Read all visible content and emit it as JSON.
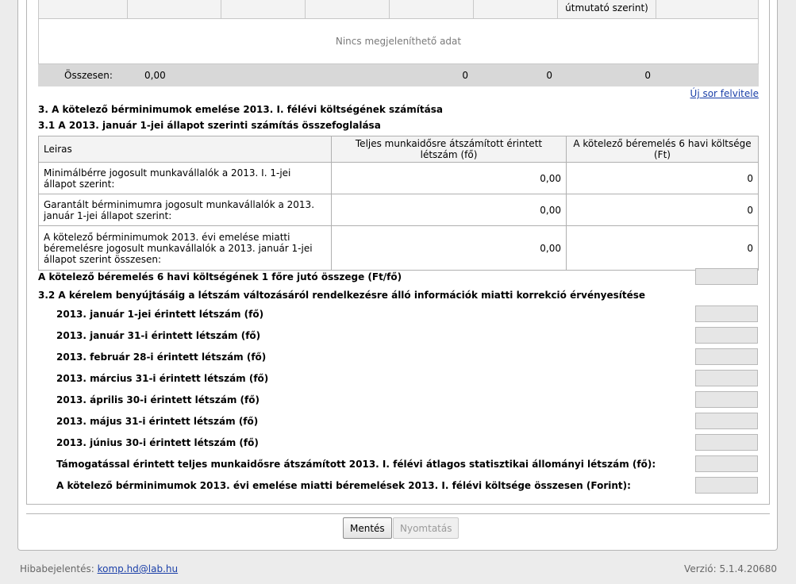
{
  "top_table": {
    "header_partial": "útmutató szerint)",
    "empty_text": "Nincs megjeleníthető adat",
    "sum_label": "Összesen:",
    "sum_values": [
      "0,00",
      "0",
      "0",
      "0"
    ]
  },
  "new_row_link": "Új sor felvitele",
  "section3_title": "3. A kötelező bérminimumok emelése 2013. I. félévi költségének számítása",
  "section31_title": "3.1 A 2013. január 1-jei állapot szerinti számítás összefoglalása",
  "summary_table": {
    "headers": [
      "Leiras",
      "Teljes munkaidősre átszámított érintett létszám (fő)",
      "A kötelező béremelés 6 havi költsége (Ft)"
    ],
    "rows": [
      {
        "label": "Minimálbérre jogosult munkavállalók a 2013. I. 1-jei állapot szerint:",
        "count": "0,00",
        "cost": "0"
      },
      {
        "label": "Garantált bérminimumra jogosult munkavállalók a 2013. január 1-jei állapot szerint:",
        "count": "0,00",
        "cost": "0"
      },
      {
        "label": "A kötelező bérminimumok 2013. évi emelése miatti béremelésre jogosult munkavállalók a 2013. január 1-jei állapot szerint összesen:",
        "count": "0,00",
        "cost": "0"
      }
    ]
  },
  "per_person_label": "A kötelező béremelés 6 havi költségének 1 főre jutó összege (Ft/fő)",
  "section32_title": "3.2 A kérelem benyújtásáig a létszám változásáról rendelkezésre álló információk miatti korrekció érvényesítése",
  "fields": [
    "2013. január 1-jei érintett létszám (fő)",
    "2013. január 31-i érintett létszám (fő)",
    "2013. február 28-i érintett létszám (fő)",
    "2013. március 31-i érintett létszám (fő)",
    "2013. április 30-i érintett létszám (fő)",
    "2013. május 31-i érintett létszám (fő)",
    "2013. június 30-i érintett létszám (fő)",
    "Támogatással érintett teljes munkaidősre átszámított 2013. I. félévi átlagos statisztikai állományi létszám (fő):",
    "A kötelező bérminimumok 2013. évi emelése miatti béremelések 2013. I. félévi költsége összesen (Forint):"
  ],
  "buttons": {
    "save": "Mentés",
    "print": "Nyomtatás"
  },
  "footer": {
    "bug_label": "Hibabejelentés:",
    "bug_email": "komp.hd@lab.hu",
    "version": "Verzió: 5.1.4.20680"
  }
}
